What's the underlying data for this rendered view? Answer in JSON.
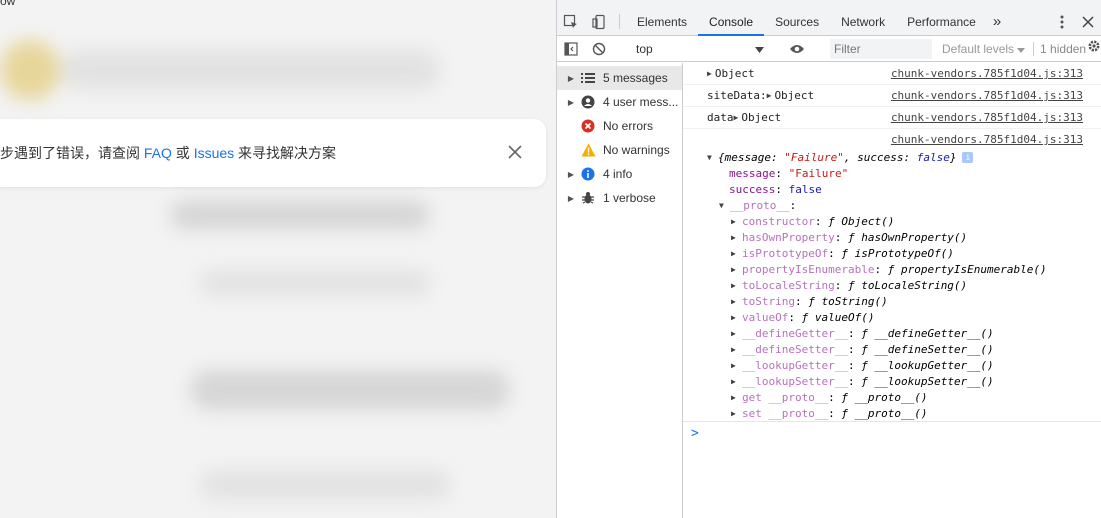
{
  "page": {
    "top_text": "ow",
    "toast": {
      "text_before": "步遇到了错误，请查阅 ",
      "link_faq": "FAQ",
      "text_mid": " 或 ",
      "link_issues": "Issues",
      "text_after": " 来寻找解决方案",
      "close_icon": "close-icon"
    }
  },
  "devtools": {
    "tabs": [
      {
        "label": "Elements"
      },
      {
        "label": "Console"
      },
      {
        "label": "Sources"
      },
      {
        "label": "Network"
      },
      {
        "label": "Performance"
      }
    ],
    "active_tab": "Console",
    "more_glyph": "»",
    "toolbar": {
      "context": "top",
      "filter_placeholder": "Filter",
      "levels": "Default levels",
      "hidden": "1 hidden"
    },
    "sidebar": [
      {
        "label": "5 messages",
        "icon": "list-icon",
        "expandable": true,
        "selected": true
      },
      {
        "label": "4 user mess...",
        "icon": "user-icon",
        "expandable": true,
        "selected": false
      },
      {
        "label": "No errors",
        "icon": "error-icon",
        "expandable": false,
        "selected": false
      },
      {
        "label": "No warnings",
        "icon": "warning-icon",
        "expandable": false,
        "selected": false
      },
      {
        "label": "4 info",
        "icon": "info-icon",
        "expandable": true,
        "selected": false
      },
      {
        "label": "1 verbose",
        "icon": "bug-icon",
        "expandable": true,
        "selected": false
      }
    ],
    "logs": [
      {
        "prefix": "",
        "value": "Object",
        "source": "chunk-vendors.785f1d04.js:313"
      },
      {
        "prefix": "siteData: ",
        "value": "Object",
        "source": "chunk-vendors.785f1d04.js:313"
      },
      {
        "prefix": "data ",
        "value": "Object",
        "source": "chunk-vendors.785f1d04.js:313"
      }
    ],
    "expanded_log": {
      "source": "chunk-vendors.785f1d04.js:313",
      "summary_open": "{",
      "summary_k1": "message",
      "summary_v1": "\"Failure\"",
      "summary_k2": "success",
      "summary_v2": "false",
      "summary_close": "}",
      "message_key": "message",
      "message_val": "\"Failure\"",
      "success_key": "success",
      "success_val": "false",
      "proto_key": "__proto__",
      "proto_entries": [
        {
          "key": "constructor",
          "fn": "Object()"
        },
        {
          "key": "hasOwnProperty",
          "fn": "hasOwnProperty()"
        },
        {
          "key": "isPrototypeOf",
          "fn": "isPrototypeOf()"
        },
        {
          "key": "propertyIsEnumerable",
          "fn": "propertyIsEnumerable()"
        },
        {
          "key": "toLocaleString",
          "fn": "toLocaleString()"
        },
        {
          "key": "toString",
          "fn": "toString()"
        },
        {
          "key": "valueOf",
          "fn": "valueOf()"
        },
        {
          "key": "__defineGetter__",
          "fn": "__defineGetter__()"
        },
        {
          "key": "__defineSetter__",
          "fn": "__defineSetter__()"
        },
        {
          "key": "__lookupGetter__",
          "fn": "__lookupGetter__()"
        },
        {
          "key": "__lookupSetter__",
          "fn": "__lookupSetter__()"
        },
        {
          "key": "get __proto__",
          "fn": "__proto__()"
        },
        {
          "key": "set __proto__",
          "fn": "__proto__()"
        }
      ]
    },
    "prompt": ">"
  }
}
